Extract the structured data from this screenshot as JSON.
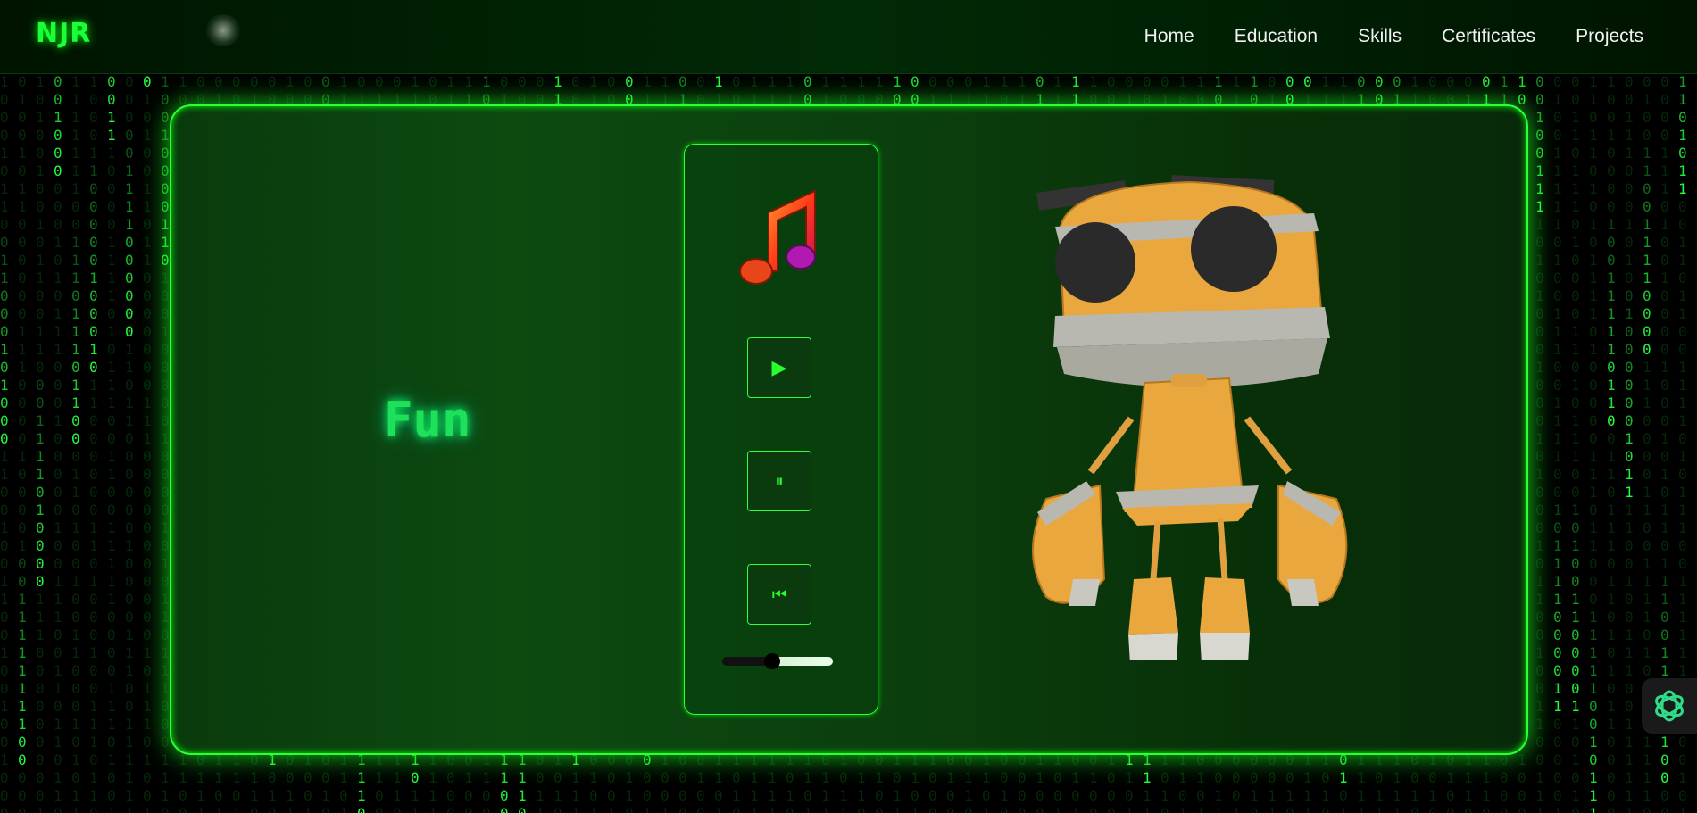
{
  "nav": {
    "logo": "NJR",
    "items": [
      {
        "label": "Home"
      },
      {
        "label": "Education"
      },
      {
        "label": "Skills"
      },
      {
        "label": "Certificates"
      },
      {
        "label": "Projects"
      }
    ]
  },
  "main": {
    "title": "Fun",
    "player": {
      "icon": "music-note-icon",
      "controls": [
        {
          "icon": "play-icon",
          "glyph": "▶"
        },
        {
          "icon": "pause-icon",
          "glyph": "⏸"
        },
        {
          "icon": "previous-icon",
          "glyph": "⏮"
        }
      ],
      "volume_level": 0.45
    },
    "illustration": "robot-3d-model"
  },
  "chat_widget": {
    "icon": "chat-assistant-icon"
  },
  "colors": {
    "accent": "#2bff3a",
    "logo": "#19ff3c",
    "background": "#000000",
    "card": "#0b3e0d"
  }
}
